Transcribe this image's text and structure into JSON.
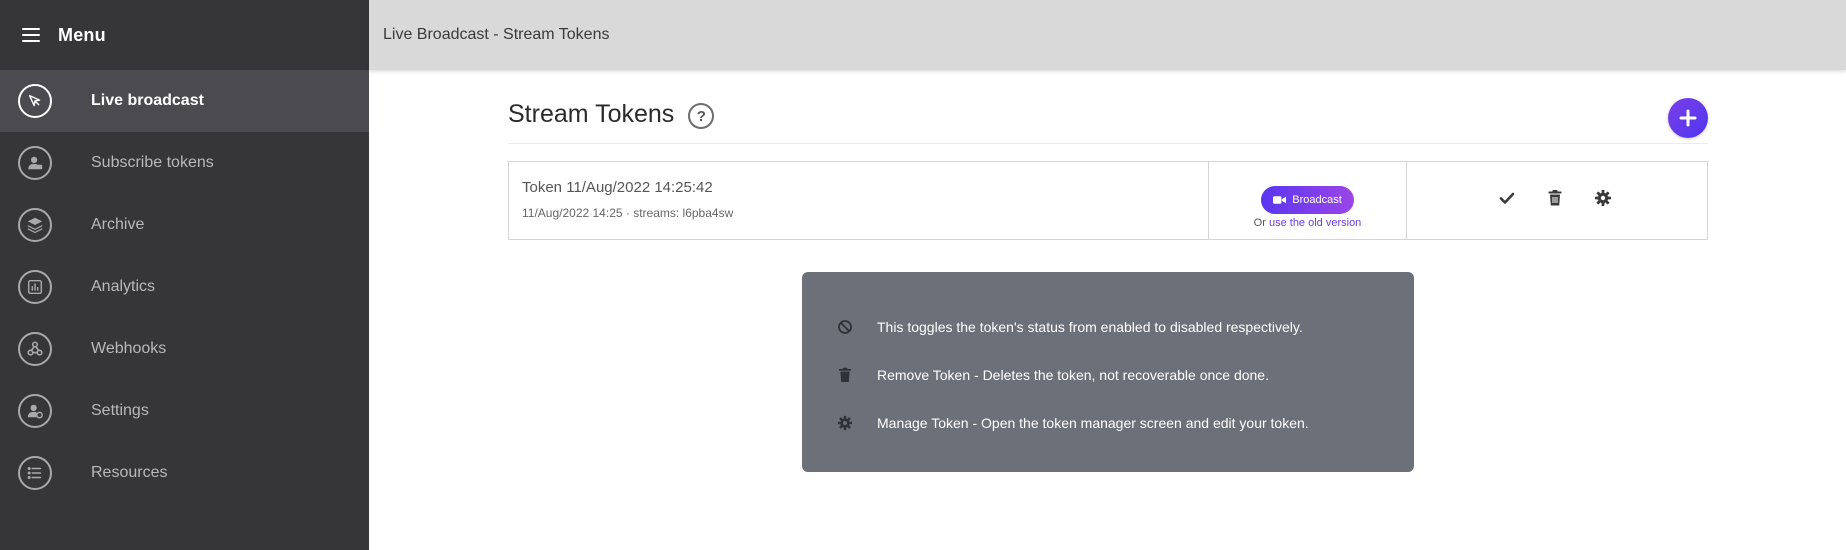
{
  "sidebar": {
    "menu_title": "Menu",
    "items": [
      {
        "label": "Live broadcast",
        "icon": "live-broadcast-icon",
        "active": true
      },
      {
        "label": "Subscribe tokens",
        "icon": "subscribe-tokens-icon"
      },
      {
        "label": "Archive",
        "icon": "archive-icon"
      },
      {
        "label": "Analytics",
        "icon": "analytics-icon"
      },
      {
        "label": "Webhooks",
        "icon": "webhooks-icon"
      },
      {
        "label": "Settings",
        "icon": "settings-icon"
      },
      {
        "label": "Resources",
        "icon": "resources-icon"
      }
    ]
  },
  "topbar": {
    "title": "Live Broadcast - Stream Tokens"
  },
  "main": {
    "title": "Stream Tokens",
    "help_label": "?",
    "add_icon": "plus-icon",
    "token": {
      "name": "Token 11/Aug/2022 14:25:42",
      "meta": "11/Aug/2022 14:25 · streams: l6pba4sw",
      "broadcast_label": "Broadcast",
      "old_version_prefix": "Or",
      "old_version_link": "use the old version",
      "actions": [
        "check-icon",
        "trash-icon",
        "gear-icon"
      ]
    },
    "help_panel": [
      {
        "icon": "ban-icon",
        "text": "This toggles the token's status from enabled to disabled respectively."
      },
      {
        "icon": "trash-icon",
        "text": "Remove Token - Deletes the token, not recoverable once done."
      },
      {
        "icon": "gear-icon",
        "text": "Manage Token - Open the token manager screen and edit your token."
      }
    ]
  },
  "colors": {
    "sidebar_bg": "#363538",
    "sidebar_active": "#4b4a4e",
    "topbar_bg": "#d9d9d9",
    "accent_start": "#5a36f0",
    "accent_end": "#9b46e8",
    "help_panel_bg": "#6b7079"
  }
}
